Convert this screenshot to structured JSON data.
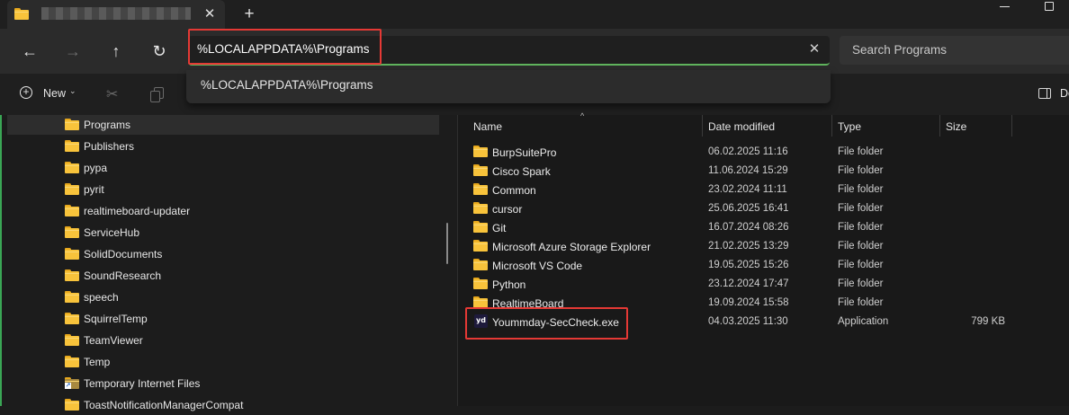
{
  "tab": {
    "title": "",
    "close_glyph": "✕",
    "new_tab_glyph": "+"
  },
  "nav": {
    "back_glyph": "←",
    "forward_glyph": "→",
    "up_glyph": "↑",
    "refresh_glyph": "↻",
    "address": "%LOCALAPPDATA%\\Programs",
    "clear_glyph": "✕",
    "search_placeholder": "Search Programs",
    "suggestion": "%LOCALAPPDATA%\\Programs"
  },
  "command_bar": {
    "new_label": "New",
    "new_glyph": "+",
    "chevron": "⌄",
    "cut_glyph": "✂",
    "details_label": "De"
  },
  "tree": {
    "items": [
      {
        "label": "Programs",
        "selected": true,
        "icon": "folder-icon"
      },
      {
        "label": "Publishers",
        "icon": "folder-icon"
      },
      {
        "label": "pypa",
        "icon": "folder-icon"
      },
      {
        "label": "pyrit",
        "icon": "folder-icon"
      },
      {
        "label": "realtimeboard-updater",
        "icon": "folder-icon"
      },
      {
        "label": "ServiceHub",
        "icon": "folder-icon"
      },
      {
        "label": "SolidDocuments",
        "icon": "folder-icon"
      },
      {
        "label": "SoundResearch",
        "icon": "folder-icon"
      },
      {
        "label": "speech",
        "icon": "folder-icon"
      },
      {
        "label": "SquirrelTemp",
        "icon": "folder-icon"
      },
      {
        "label": "TeamViewer",
        "icon": "folder-icon"
      },
      {
        "label": "Temp",
        "icon": "folder-icon"
      },
      {
        "label": "Temporary Internet Files",
        "icon": "folder-shortcut-icon"
      },
      {
        "label": "ToastNotificationManagerCompat",
        "icon": "folder-icon"
      }
    ]
  },
  "columns": {
    "name": "Name",
    "date": "Date modified",
    "type": "Type",
    "size": "Size",
    "sort_glyph": "^"
  },
  "files": [
    {
      "name": "BurpSuitePro",
      "date": "06.02.2025 11:16",
      "type": "File folder",
      "size": ""
    },
    {
      "name": "Cisco Spark",
      "date": "11.06.2024 15:29",
      "type": "File folder",
      "size": ""
    },
    {
      "name": "Common",
      "date": "23.02.2024 11:11",
      "type": "File folder",
      "size": ""
    },
    {
      "name": "cursor",
      "date": "25.06.2025 16:41",
      "type": "File folder",
      "size": ""
    },
    {
      "name": "Git",
      "date": "16.07.2024 08:26",
      "type": "File folder",
      "size": ""
    },
    {
      "name": "Microsoft Azure Storage Explorer",
      "date": "21.02.2025 13:29",
      "type": "File folder",
      "size": ""
    },
    {
      "name": "Microsoft VS Code",
      "date": "19.05.2025 15:26",
      "type": "File folder",
      "size": ""
    },
    {
      "name": "Python",
      "date": "23.12.2024 17:47",
      "type": "File folder",
      "size": ""
    },
    {
      "name": "RealtimeBoard",
      "date": "19.09.2024 15:58",
      "type": "File folder",
      "size": ""
    },
    {
      "name": "Yoummday-SecCheck.exe",
      "date": "04.03.2025 11:30",
      "type": "Application",
      "size": "799 KB",
      "icon_text": "yd"
    }
  ],
  "colors": {
    "accent_green": "#5fb25c",
    "highlight_red": "#e53935",
    "folder_yellow": "#f8c33b"
  }
}
